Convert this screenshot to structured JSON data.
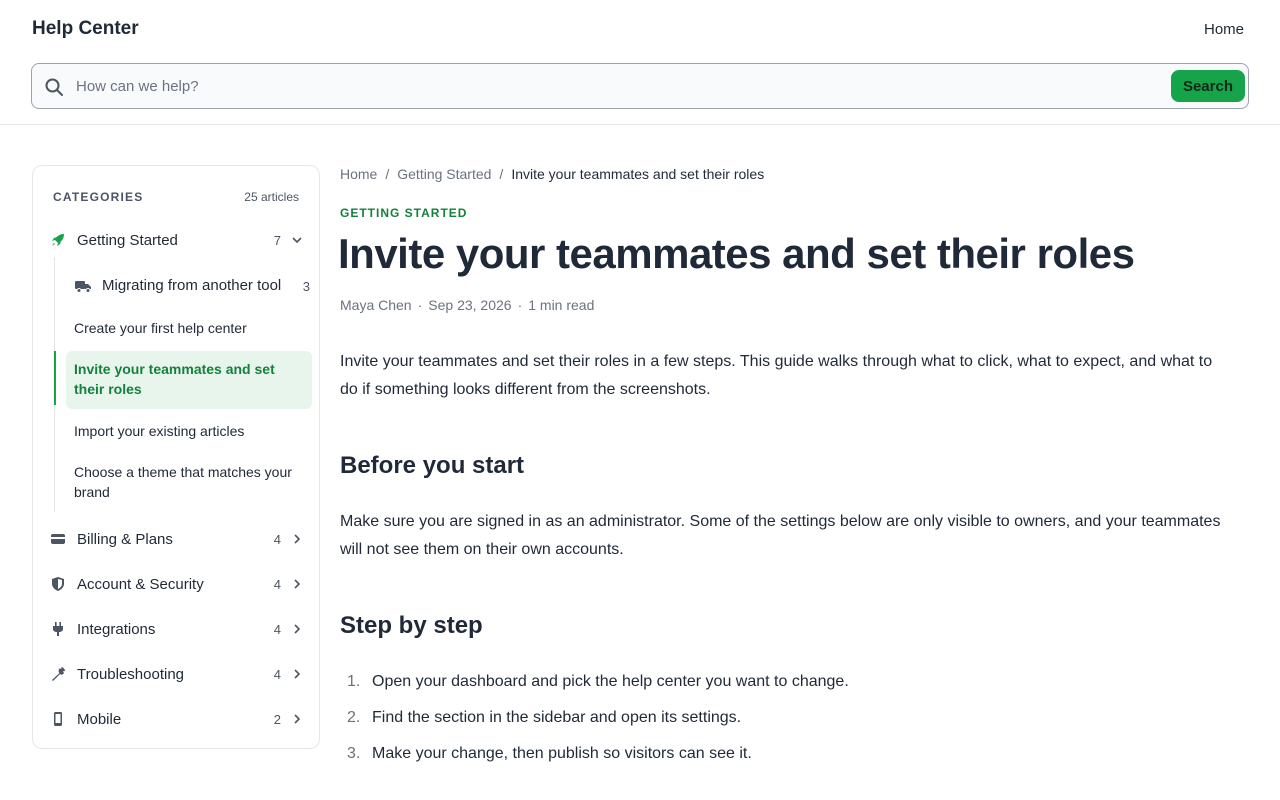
{
  "header": {
    "brand": "Help Center",
    "nav_home": "Home",
    "search_placeholder": "How can we help?",
    "search_button": "Search"
  },
  "sidebar": {
    "heading": "CATEGORIES",
    "total": "25 articles",
    "categories": [
      {
        "label": "Getting Started",
        "count": "7",
        "icon": "rocket-icon",
        "expanded": true
      },
      {
        "label": "Billing & Plans",
        "count": "4",
        "icon": "credit-card-icon"
      },
      {
        "label": "Account & Security",
        "count": "4",
        "icon": "shield-icon"
      },
      {
        "label": "Integrations",
        "count": "4",
        "icon": "plug-icon"
      },
      {
        "label": "Troubleshooting",
        "count": "4",
        "icon": "wrench-icon"
      },
      {
        "label": "Mobile",
        "count": "2",
        "icon": "phone-icon"
      }
    ],
    "sub_group": {
      "label": "Migrating from another tool",
      "count": "3",
      "icon": "truck-icon"
    },
    "sub_items": [
      "Create your first help center",
      "Invite your teammates and set their roles",
      "Import your existing articles",
      "Choose a theme that matches your brand"
    ]
  },
  "breadcrumb": [
    "Home",
    "Getting Started",
    "Invite your teammates and set their roles"
  ],
  "article": {
    "eyebrow": "GETTING STARTED",
    "title": "Invite your teammates and set their roles",
    "author": "Maya Chen",
    "date": "Sep 23, 2026",
    "read_time": "1 min read",
    "intro": "Invite your teammates and set their roles in a few steps. This guide walks through what to click, what to expect, and what to do if something looks different from the screenshots.",
    "h_before": "Before you start",
    "before_text": "Make sure you are signed in as an administrator. Some of the settings below are only visible to owners, and your teammates will not see them on their own accounts.",
    "h_steps": "Step by step",
    "steps": [
      {
        "n": "1.",
        "text": "Open your dashboard and pick the help center you want to change."
      },
      {
        "n": "2.",
        "text": "Find the section in the sidebar and open its settings."
      },
      {
        "n": "3.",
        "text": "Make your change, then publish so visitors can see it."
      }
    ]
  },
  "colors": {
    "accent": "#16a34a",
    "accent_text": "#15803d",
    "active_bg": "#e8f5ec"
  }
}
